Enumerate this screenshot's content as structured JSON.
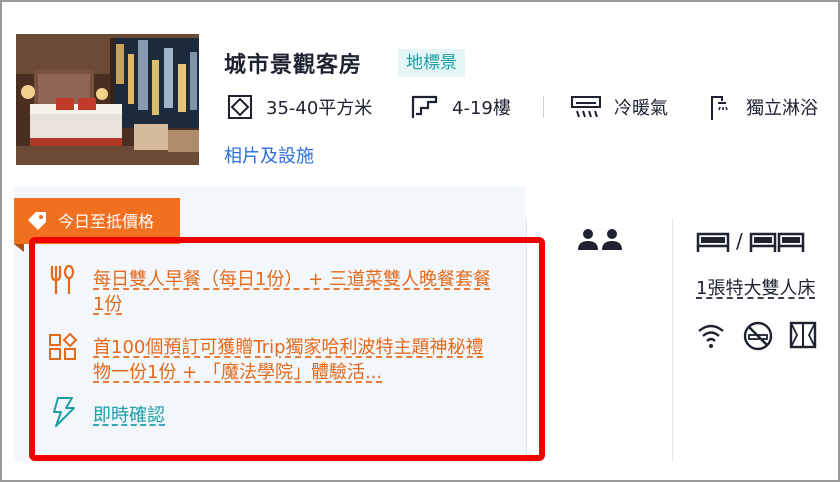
{
  "room": {
    "title": "城市景觀客房",
    "view_tag": "地標景",
    "attributes": [
      {
        "icon": "area-icon",
        "label": "35-40平方米"
      },
      {
        "icon": "stairs-floor-icon",
        "label": "4-19樓"
      },
      {
        "icon": "air-conditioner-icon",
        "label": "冷暖氣"
      },
      {
        "icon": "shower-icon",
        "label": "獨立淋浴"
      }
    ],
    "photos_link": "相片及設施"
  },
  "offer": {
    "badge": "今日至抵價格",
    "perks": [
      {
        "icon": "dining-icon",
        "text": "每日雙人早餐（每日1份） + 三道菜雙人晚餐套餐1份"
      },
      {
        "icon": "gift-icon",
        "text": "首100個預訂可獲贈Trip獨家哈利波特主題神秘禮物一份1份 + 「魔法學院」體驗活..."
      }
    ],
    "instant_confirm": "即時確認"
  },
  "occupancy": {
    "icon": "two-guests-icon"
  },
  "beds": {
    "separator": "/",
    "text": "1張特大雙人床"
  },
  "amenities": [
    "wifi-icon",
    "no-smoking-icon",
    "window-icon"
  ],
  "colors": {
    "accent_orange": "#f07020",
    "highlight_red": "#f20000",
    "link_blue": "#2d6ee0",
    "teal": "#1a9fa8"
  }
}
